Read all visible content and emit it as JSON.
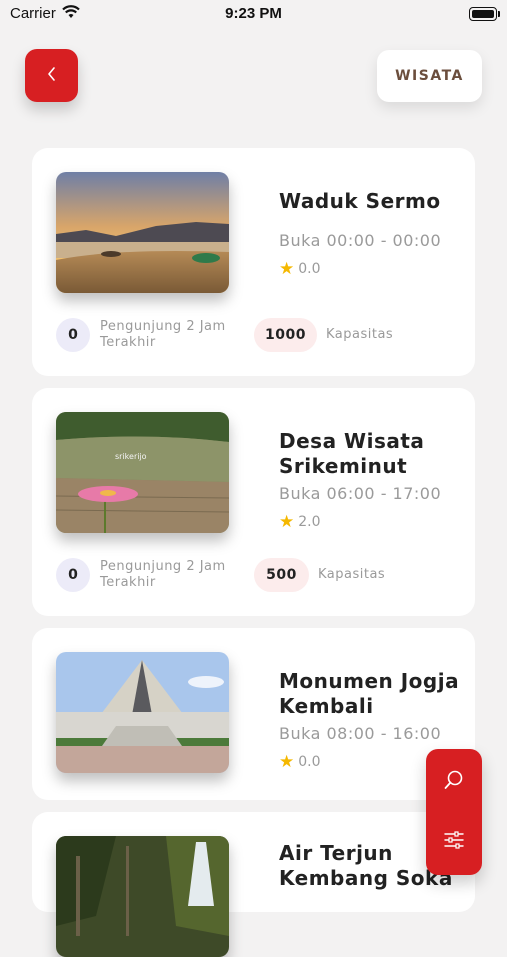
{
  "status_bar": {
    "carrier": "Carrier",
    "time": "9:23 PM"
  },
  "header": {
    "category_label": "WISATA"
  },
  "places": [
    {
      "name": "Waduk Sermo",
      "hours": "Buka 00:00 - 00:00",
      "rating": "0.0",
      "visitors": "0",
      "visitors_label": "Pengunjung 2 Jam Terakhir",
      "capacity": "1000",
      "capacity_label": "Kapasitas"
    },
    {
      "name": "Desa Wisata Srikeminut",
      "hours": "Buka 06:00 - 17:00",
      "rating": "2.0",
      "visitors": "0",
      "visitors_label": "Pengunjung 2 Jam Terakhir",
      "capacity": "500",
      "capacity_label": "Kapasitas",
      "sign_text": "srikerijo"
    },
    {
      "name": "Monumen Jogja Kembali",
      "hours": "Buka 08:00 - 16:00",
      "rating": "0.0"
    },
    {
      "name": "Air Terjun Kembang Soka"
    }
  ],
  "icons": {
    "back": "chevron-left-icon",
    "search": "search-icon",
    "filter": "sliders-icon",
    "star": "star-icon"
  },
  "colors": {
    "accent": "#d71f22",
    "category_text": "#6b4e3d",
    "star": "#f5b800"
  }
}
